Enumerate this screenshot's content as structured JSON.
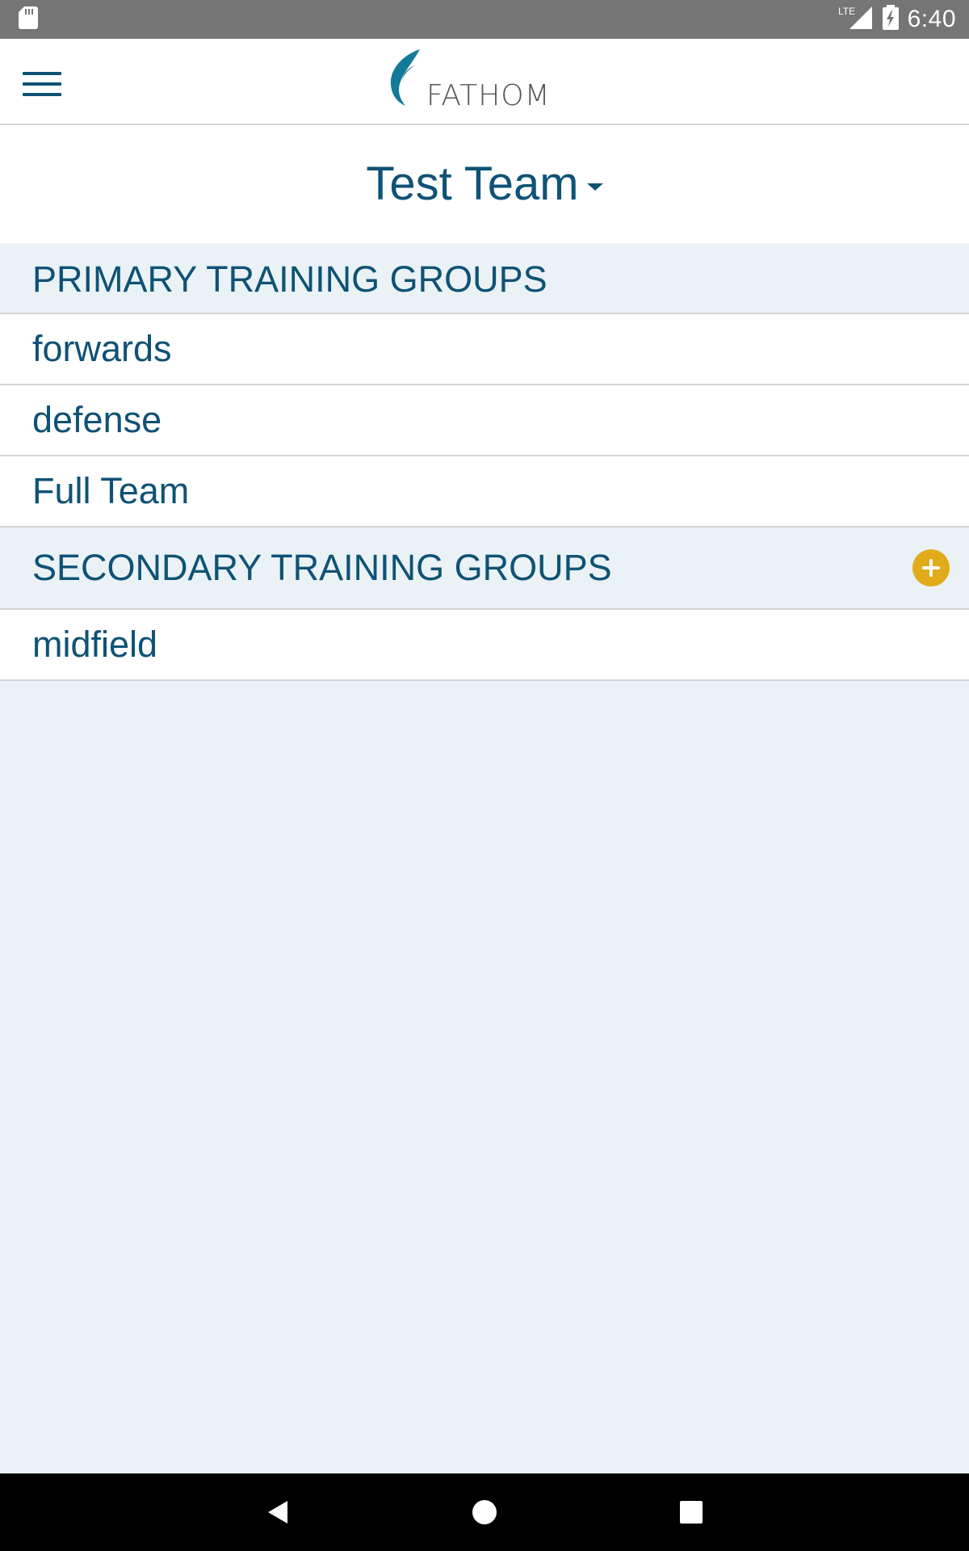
{
  "status_bar": {
    "time": "6:40",
    "network": "LTE",
    "icons": [
      "sd-card-icon",
      "signal-icon",
      "battery-charging-icon"
    ]
  },
  "app_bar": {
    "brand": "FATHOM",
    "icons": [
      "menu-icon",
      "fathom-logo-icon"
    ]
  },
  "team": {
    "name": "Test Team",
    "icon": "caret-down-icon"
  },
  "primary_groups": {
    "header": "PRIMARY TRAINING GROUPS",
    "items": [
      "forwards",
      "defense",
      "Full Team"
    ]
  },
  "secondary_groups": {
    "header": "SECONDARY TRAINING GROUPS",
    "add_icon": "add-circle-icon",
    "items": [
      "midfield"
    ]
  },
  "nav_bar": {
    "icons": [
      "back-icon",
      "home-icon",
      "recents-icon"
    ]
  },
  "colors": {
    "primary": "#0f5275",
    "accent": "#e1ac1c",
    "background": "#eaf2f6",
    "status_bar": "#757575"
  }
}
